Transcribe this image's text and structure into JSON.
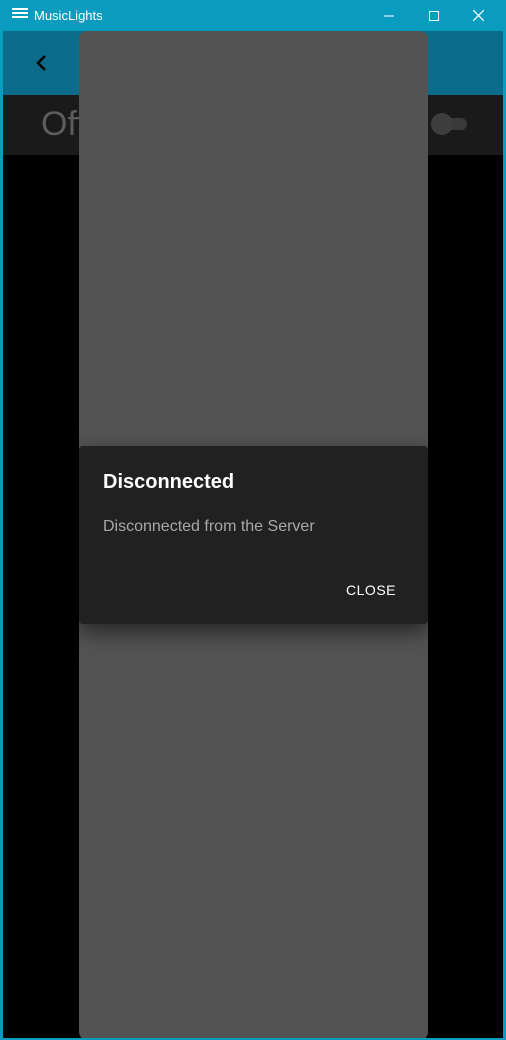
{
  "window": {
    "title": "MusicLights",
    "icons": {
      "app": "app-logo-icon",
      "minimize": "minimize-icon",
      "maximize": "maximize-icon",
      "close": "close-icon"
    },
    "accent_color": "#0a9cbf"
  },
  "header": {
    "back_icon": "chevron-left-icon",
    "background": "#0b6c8a"
  },
  "status": {
    "label": "Off",
    "toggle_on": false
  },
  "dialog": {
    "title": "Disconnected",
    "message": "Disconnected from the Server",
    "close_label": "CLOSE"
  }
}
